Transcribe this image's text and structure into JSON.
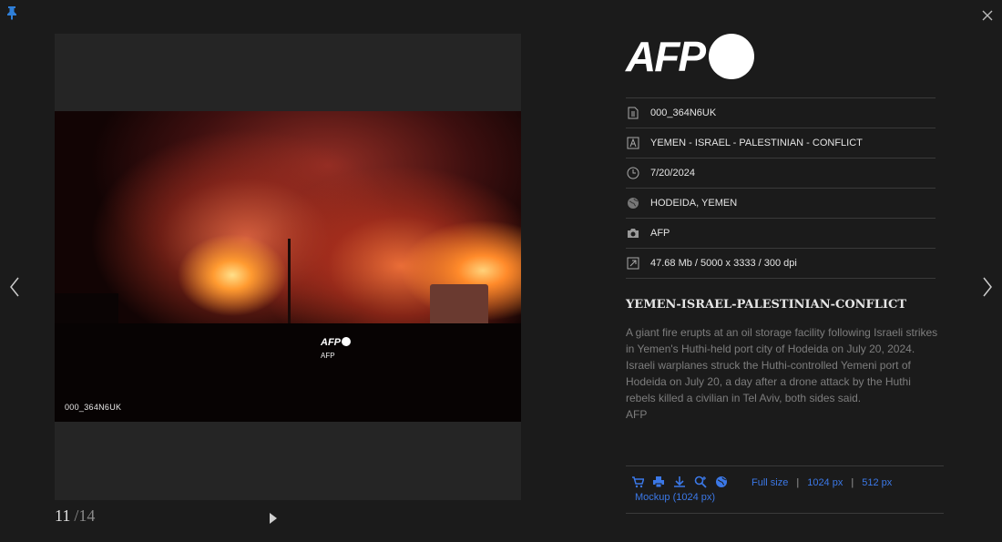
{
  "photo": {
    "id_overlay": "000_364N6UK",
    "watermark_logo": "AFP",
    "watermark_credit": "AFP"
  },
  "pagination": {
    "current": "11",
    "total": "/14"
  },
  "brand": {
    "logo_text": "AFP"
  },
  "metadata": {
    "reference": "000_364N6UK",
    "headline": "YEMEN - ISRAEL - PALESTINIAN - CONFLICT",
    "date": "7/20/2024",
    "location": "HODEIDA, YEMEN",
    "credit": "AFP",
    "file_info": "47.68 Mb / 5000 x 3333 / 300 dpi"
  },
  "caption": {
    "title": "YEMEN-ISRAEL-PALESTINIAN-CONFLICT",
    "body": "A giant fire erupts at an oil storage facility following Israeli strikes in Yemen's Huthi-held port city of Hodeida on July 20, 2024. Israeli warplanes struck the Huthi-controlled Yemeni port of Hodeida on July 20, a day after a drone attack by the Huthi rebels killed a civilian in Tel Aviv, both sides said.",
    "credit": "AFP"
  },
  "actions": {
    "icons": [
      "cart-icon",
      "print-icon",
      "download-icon",
      "zoom-icon",
      "globe-icon"
    ],
    "full_size": "Full size",
    "size_1024": "1024 px",
    "size_512": "512 px",
    "mockup": "Mockup (1024 px)"
  },
  "colors": {
    "background": "#1b1b1b",
    "link": "#3b78e7",
    "pin": "#2f7fd8"
  }
}
